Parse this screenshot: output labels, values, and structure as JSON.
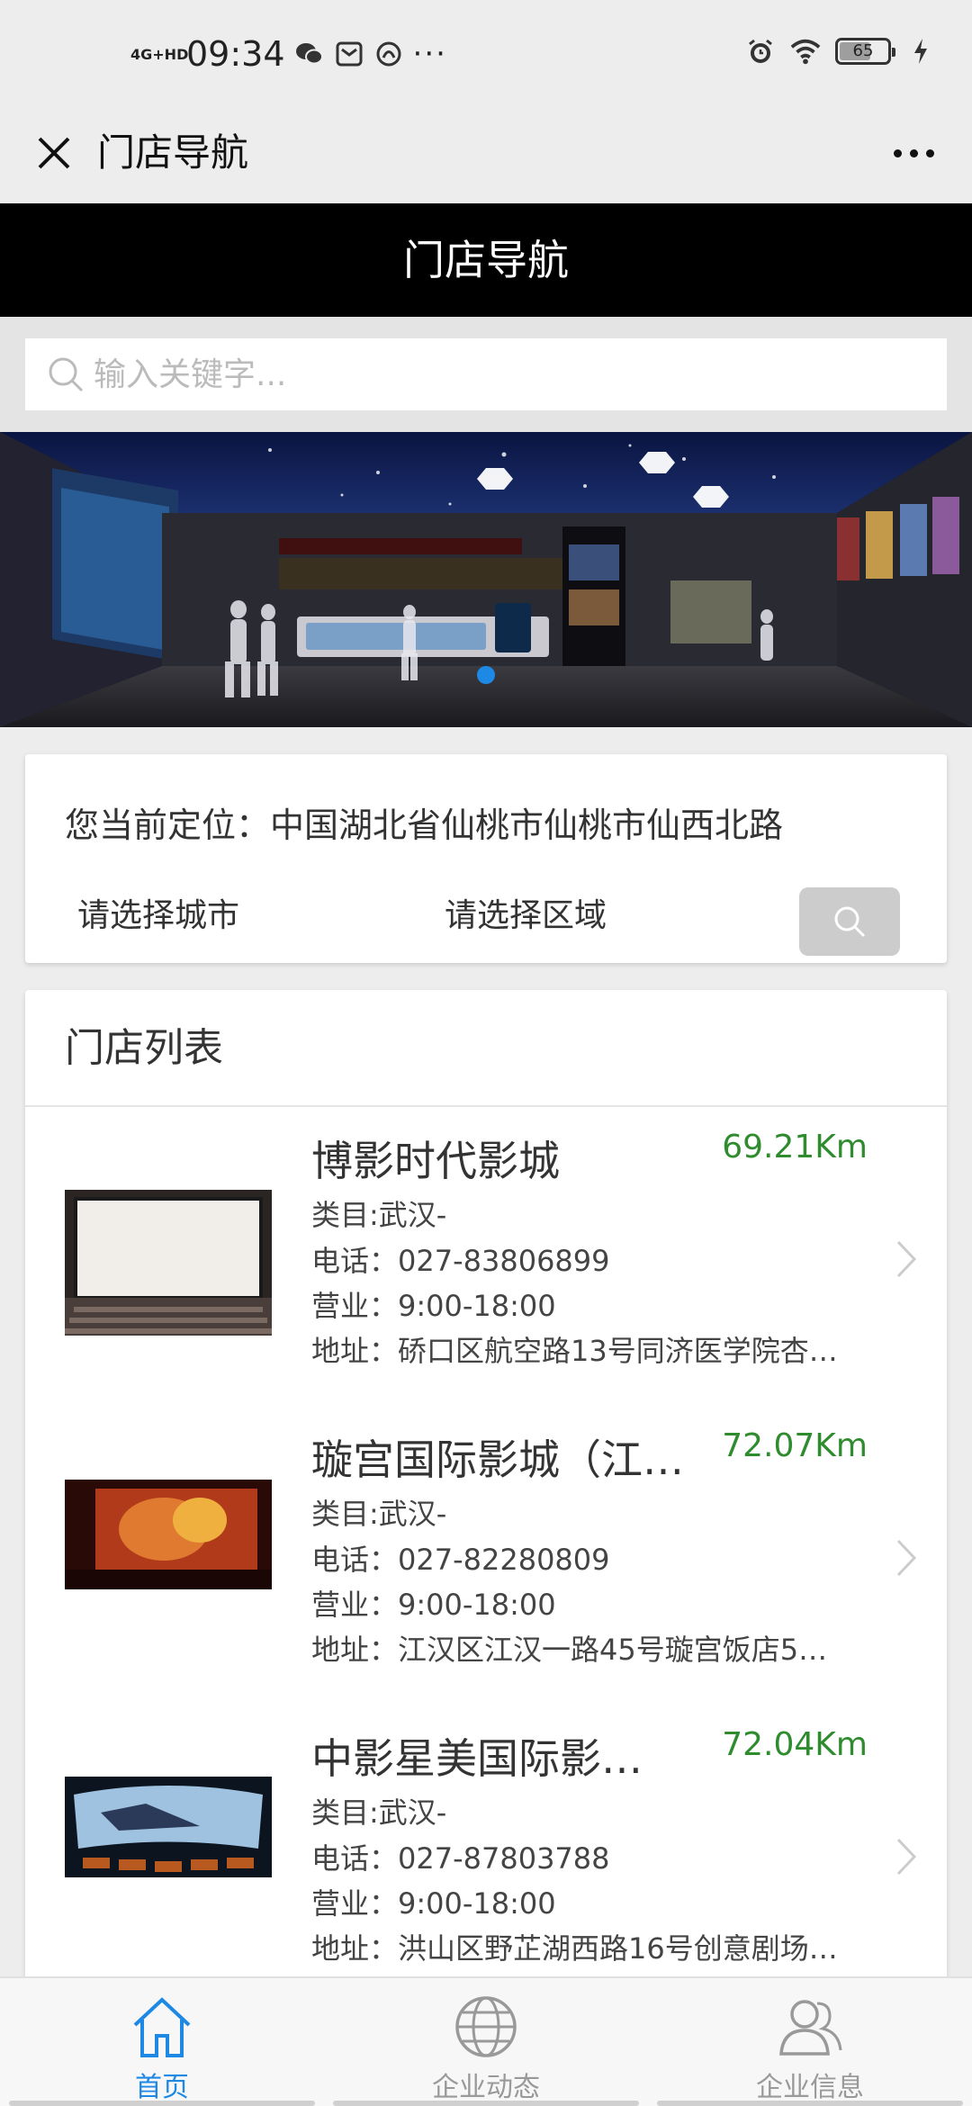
{
  "status_bar": {
    "network": "4G+HD",
    "time": "09:34",
    "battery": "65",
    "battery_level": 0.65
  },
  "nav": {
    "title": "门店导航"
  },
  "header": {
    "title": "门店导航"
  },
  "search": {
    "placeholder": "输入关键字..."
  },
  "location": {
    "current": "您当前定位：中国湖北省仙桃市仙桃市仙西北路",
    "select_city": "请选择城市",
    "select_area": "请选择区域"
  },
  "store_list": {
    "title": "门店列表",
    "stores": [
      {
        "name": "博影时代影城",
        "distance": "69.21Km",
        "category": "类目:武汉-",
        "phone": "电话：027-83806899",
        "hours": "营业：9:00-18:00",
        "address": "地址：硚口区航空路13号同济医学院杏…"
      },
      {
        "name": "璇宫国际影城（江…",
        "distance": "72.07Km",
        "category": "类目:武汉-",
        "phone": "电话：027-82280809",
        "hours": "营业：9:00-18:00",
        "address": "地址：江汉区江汉一路45号璇宫饭店5…"
      },
      {
        "name": "中影星美国际影…",
        "distance": "72.04Km",
        "category": "类目:武汉-",
        "phone": "电话：027-87803788",
        "hours": "营业：9:00-18:00",
        "address": "地址：洪山区野芷湖西路16号创意剧场…"
      }
    ]
  },
  "tabs": [
    {
      "label": "首页",
      "icon": "home-icon",
      "active": true
    },
    {
      "label": "企业动态",
      "icon": "globe-icon",
      "active": false
    },
    {
      "label": "企业信息",
      "icon": "users-icon",
      "active": false
    }
  ],
  "colors": {
    "accent": "#1e88e5",
    "distance": "#2e8b2e",
    "header_bg": "#000000"
  }
}
